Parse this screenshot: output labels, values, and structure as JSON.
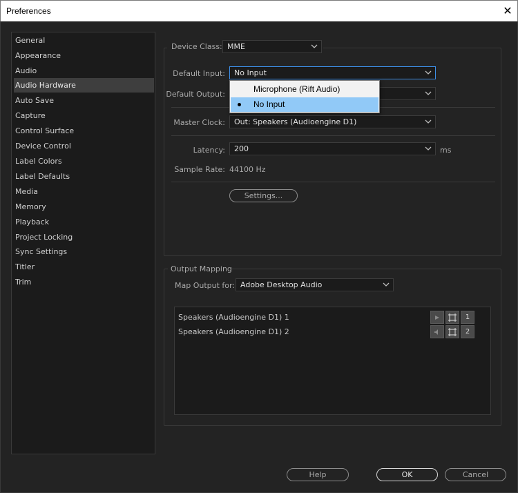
{
  "window": {
    "title": "Preferences",
    "close_glyph": "✕"
  },
  "sidebar": {
    "items": [
      {
        "label": "General"
      },
      {
        "label": "Appearance"
      },
      {
        "label": "Audio"
      },
      {
        "label": "Audio Hardware",
        "selected": true
      },
      {
        "label": "Auto Save"
      },
      {
        "label": "Capture"
      },
      {
        "label": "Control Surface"
      },
      {
        "label": "Device Control"
      },
      {
        "label": "Label Colors"
      },
      {
        "label": "Label Defaults"
      },
      {
        "label": "Media"
      },
      {
        "label": "Memory"
      },
      {
        "label": "Playback"
      },
      {
        "label": "Project Locking"
      },
      {
        "label": "Sync Settings"
      },
      {
        "label": "Titler"
      },
      {
        "label": "Trim"
      }
    ]
  },
  "audio_hardware": {
    "device_class": {
      "label": "Device Class:",
      "value": "MME"
    },
    "default_input": {
      "label": "Default Input:",
      "value": "No Input"
    },
    "default_output": {
      "label": "Default Output:",
      "value": ""
    },
    "master_clock": {
      "label": "Master Clock:",
      "value": "Out: Speakers (Audioengine D1)"
    },
    "latency": {
      "label": "Latency:",
      "value": "200",
      "unit": "ms"
    },
    "sample_rate": {
      "label": "Sample Rate:",
      "value": "44100 Hz"
    },
    "settings_button": "Settings..."
  },
  "input_dropdown_popup": {
    "options": [
      {
        "label": "Microphone (Rift Audio)",
        "selected": false
      },
      {
        "label": "No Input",
        "selected": true
      }
    ]
  },
  "output_mapping": {
    "group_title": "Output Mapping",
    "map_output_for": {
      "label": "Map Output for:",
      "value": "Adobe Desktop Audio"
    },
    "channels": [
      {
        "name": "Speakers (Audioengine D1) 1",
        "number": "1",
        "icons": [
          "play-icon",
          "frame-icon"
        ]
      },
      {
        "name": "Speakers (Audioengine D1) 2",
        "number": "2",
        "icons": [
          "speaker-icon",
          "frame-icon"
        ]
      }
    ]
  },
  "footer": {
    "help": "Help",
    "ok": "OK",
    "cancel": "Cancel"
  },
  "colors": {
    "background": "#232323",
    "panel": "#1b1b1b",
    "accent": "#3d8ee6",
    "highlight": "#91c9f7"
  }
}
